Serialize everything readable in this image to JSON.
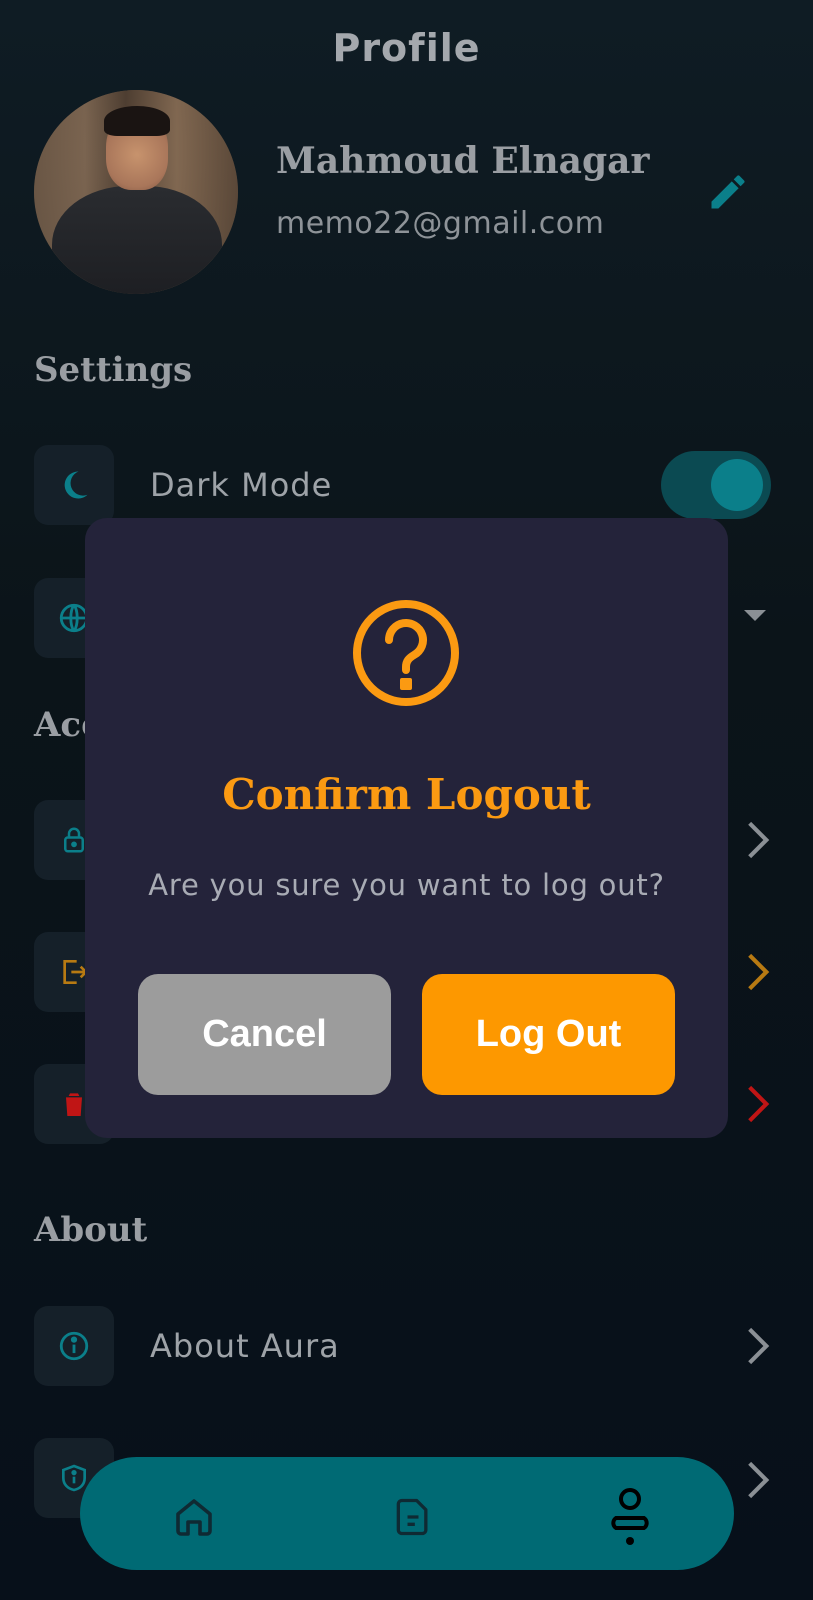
{
  "header": {
    "title": "Profile"
  },
  "profile": {
    "name": "Mahmoud Elnagar",
    "email": "memo22@gmail.com"
  },
  "sections": {
    "settings": "Settings",
    "account": "Acc",
    "about": "About"
  },
  "settings_items": [
    {
      "label": "Dark Mode",
      "icon": "moon-icon",
      "toggle": true
    }
  ],
  "about_items": [
    {
      "label": "About Aura",
      "icon": "info-icon"
    }
  ],
  "dialog": {
    "title": "Confirm Logout",
    "message": "Are you sure you want to log out?",
    "cancel_label": "Cancel",
    "confirm_label": "Log Out",
    "icon": "question-circle-icon"
  },
  "nav": [
    {
      "name": "home",
      "icon": "home-icon"
    },
    {
      "name": "docs",
      "icon": "document-icon"
    },
    {
      "name": "profile",
      "icon": "person-icon"
    }
  ],
  "colors": {
    "accent": "#0b7f8a",
    "warning": "#fd9800",
    "danger": "#d51a1a",
    "dialog_bg": "#24233a",
    "nav_bg": "#006a74"
  }
}
